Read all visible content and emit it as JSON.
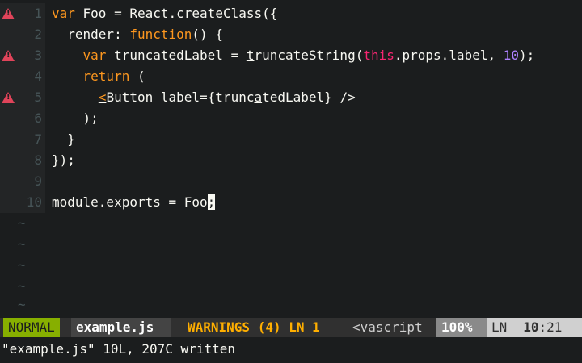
{
  "editor": {
    "lines": [
      {
        "num": "1",
        "sign": true
      },
      {
        "num": "2",
        "sign": false
      },
      {
        "num": "3",
        "sign": true
      },
      {
        "num": "4",
        "sign": false
      },
      {
        "num": "5",
        "sign": true
      },
      {
        "num": "6",
        "sign": false
      },
      {
        "num": "7",
        "sign": false
      },
      {
        "num": "8",
        "sign": false
      },
      {
        "num": "9",
        "sign": false
      },
      {
        "num": "10",
        "sign": false
      }
    ],
    "code": {
      "l1": {
        "kw": "var",
        "a": " Foo = ",
        "r": "R",
        "b": "eact.createClass({"
      },
      "l2": {
        "a": "  render: ",
        "kw": "function",
        "b": "() {"
      },
      "l3": {
        "pre": "    ",
        "kw": "var",
        "a": " truncatedLabel = ",
        "t": "t",
        "b": "runcateString(",
        "this": "this",
        "c": ".props.label, ",
        "num": "10",
        "d": ");"
      },
      "l4": {
        "pre": "    ",
        "kw": "return",
        "a": " ("
      },
      "l5": {
        "pre": "      ",
        "lt": "<",
        "a": "Button label={trunc",
        "u": "a",
        "b": "tedLabel} />"
      },
      "l6": {
        "a": "    );"
      },
      "l7": {
        "a": "  }"
      },
      "l8": {
        "a": "});"
      },
      "l9": {
        "a": ""
      },
      "l10": {
        "a": "module.exports = Foo",
        "cursor": ";"
      }
    },
    "tilde": "~"
  },
  "statusline": {
    "mode": "NORMAL",
    "filename": "example.js",
    "warnings": "WARNINGS (4) LN 1",
    "filetype": "<vascript",
    "percent": "100%",
    "ln_label": "LN",
    "line": "10",
    "col": ":21"
  },
  "cmdline": {
    "message": "\"example.js\" 10L, 207C written"
  },
  "colors": {
    "background": "#1b1d1e",
    "keyword": "#fd971f",
    "this": "#f92672",
    "number": "#ae81ff",
    "mode_bg": "#87af00",
    "warnings": "#ffaf00",
    "sign": "#e0445a"
  }
}
